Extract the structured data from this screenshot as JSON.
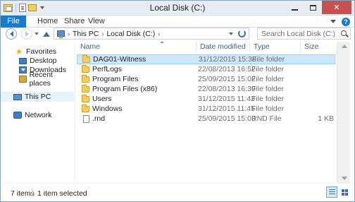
{
  "window": {
    "title": "Local Disk (C:)",
    "controls": [
      "minimize",
      "maximize",
      "close"
    ],
    "close_glyph": "✕"
  },
  "ribbon": {
    "tabs": [
      {
        "label": "File"
      },
      {
        "label": "Home"
      },
      {
        "label": "Share"
      },
      {
        "label": "View"
      }
    ],
    "help_glyph": "?"
  },
  "address_bar": {
    "crumbs": [
      "This PC",
      "Local Disk (C:)"
    ],
    "separator": "›"
  },
  "search": {
    "placeholder": "Search Local Disk (C:)"
  },
  "nav_pane": {
    "favorites": {
      "label": "Favorites",
      "items": [
        {
          "label": "Desktop",
          "icon": "desktop-icon"
        },
        {
          "label": "Downloads",
          "icon": "downloads-icon"
        },
        {
          "label": "Recent places",
          "icon": "recent-places-icon"
        }
      ]
    },
    "this_pc": {
      "label": "This PC",
      "selected": true
    },
    "network": {
      "label": "Network"
    }
  },
  "file_list": {
    "columns": [
      "Name",
      "Date modified",
      "Type",
      "Size"
    ],
    "rows": [
      {
        "name": "DAG01-Witness",
        "date": "31/12/2015 15:38",
        "type": "File folder",
        "size": "",
        "icon": "folder-icon",
        "selected": true
      },
      {
        "name": "PerfLogs",
        "date": "22/08/2013 16:52",
        "type": "File folder",
        "size": "",
        "icon": "folder-icon"
      },
      {
        "name": "Program Files",
        "date": "25/09/2015 15:02",
        "type": "File folder",
        "size": "",
        "icon": "folder-icon"
      },
      {
        "name": "Program Files (x86)",
        "date": "22/08/2013 16:39",
        "type": "File folder",
        "size": "",
        "icon": "folder-icon"
      },
      {
        "name": "Users",
        "date": "31/12/2015 11:43",
        "type": "File folder",
        "size": "",
        "icon": "folder-icon"
      },
      {
        "name": "Windows",
        "date": "31/12/2015 11:45",
        "type": "File folder",
        "size": "",
        "icon": "folder-icon"
      },
      {
        "name": ".rnd",
        "date": "25/09/2015 15:03",
        "type": "RND File",
        "size": "1 KB",
        "icon": "file-icon"
      }
    ]
  },
  "status_bar": {
    "item_count": "7 items",
    "selection": "1 item selected"
  },
  "colors": {
    "file_tab": "#1979ca",
    "selection_bg": "#cce8ff",
    "selection_border": "#99d1ff",
    "close_button": "#c75050"
  }
}
